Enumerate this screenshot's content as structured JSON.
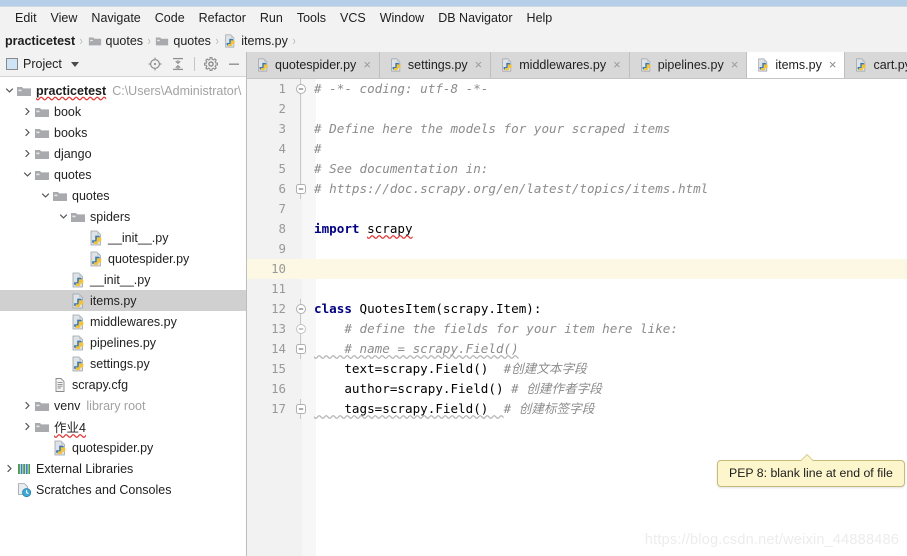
{
  "window": {
    "title_strip_color": "#b6cfe8"
  },
  "menubar": {
    "items": [
      {
        "label": "Edit",
        "mnemonic": "E"
      },
      {
        "label": "View",
        "mnemonic": "V"
      },
      {
        "label": "Navigate",
        "mnemonic": "N"
      },
      {
        "label": "Code",
        "mnemonic": "C"
      },
      {
        "label": "Refactor",
        "mnemonic": "R"
      },
      {
        "label": "Run",
        "mnemonic": "u"
      },
      {
        "label": "Tools",
        "mnemonic": "T"
      },
      {
        "label": "VCS",
        "mnemonic": "S"
      },
      {
        "label": "Window",
        "mnemonic": "W"
      },
      {
        "label": "DB Navigator",
        "mnemonic": "DB"
      },
      {
        "label": "Help",
        "mnemonic": "H"
      }
    ]
  },
  "breadcrumb": {
    "items": [
      {
        "label": "practicetest",
        "icon": "none",
        "bold": true
      },
      {
        "label": "quotes",
        "icon": "folder-icon",
        "bold": false
      },
      {
        "label": "quotes",
        "icon": "folder-icon",
        "bold": false
      },
      {
        "label": "items.py",
        "icon": "python-file-icon",
        "bold": false
      }
    ],
    "separator": "›"
  },
  "project_panel": {
    "title": "Project",
    "tools": [
      "locate-icon",
      "collapse-all-icon",
      "gear-icon",
      "minimize-icon"
    ],
    "tree": [
      {
        "depth": 0,
        "arrow": "down",
        "icon": "folder-icon",
        "label": "practicetest",
        "bold": true,
        "path": "C:\\Users\\Administrator\\",
        "selected": false,
        "squiggle": true
      },
      {
        "depth": 1,
        "arrow": "right",
        "icon": "folder-icon",
        "label": "book",
        "bold": false,
        "path": "",
        "selected": false,
        "squiggle": false
      },
      {
        "depth": 1,
        "arrow": "right",
        "icon": "folder-icon",
        "label": "books",
        "bold": false,
        "path": "",
        "selected": false,
        "squiggle": false
      },
      {
        "depth": 1,
        "arrow": "right",
        "icon": "folder-icon",
        "label": "django",
        "bold": false,
        "path": "",
        "selected": false,
        "squiggle": false
      },
      {
        "depth": 1,
        "arrow": "down",
        "icon": "folder-icon",
        "label": "quotes",
        "bold": false,
        "path": "",
        "selected": false,
        "squiggle": false
      },
      {
        "depth": 2,
        "arrow": "down",
        "icon": "folder-icon",
        "label": "quotes",
        "bold": false,
        "path": "",
        "selected": false,
        "squiggle": false
      },
      {
        "depth": 3,
        "arrow": "down",
        "icon": "folder-icon",
        "label": "spiders",
        "bold": false,
        "path": "",
        "selected": false,
        "squiggle": false
      },
      {
        "depth": 4,
        "arrow": "none",
        "icon": "python-file-icon",
        "label": "__init__.py",
        "bold": false,
        "path": "",
        "selected": false,
        "squiggle": false
      },
      {
        "depth": 4,
        "arrow": "none",
        "icon": "python-file-icon",
        "label": "quotespider.py",
        "bold": false,
        "path": "",
        "selected": false,
        "squiggle": false
      },
      {
        "depth": 3,
        "arrow": "none",
        "icon": "python-file-icon",
        "label": "__init__.py",
        "bold": false,
        "path": "",
        "selected": false,
        "squiggle": false
      },
      {
        "depth": 3,
        "arrow": "none",
        "icon": "python-file-icon",
        "label": "items.py",
        "bold": false,
        "path": "",
        "selected": true,
        "squiggle": false
      },
      {
        "depth": 3,
        "arrow": "none",
        "icon": "python-file-icon",
        "label": "middlewares.py",
        "bold": false,
        "path": "",
        "selected": false,
        "squiggle": false
      },
      {
        "depth": 3,
        "arrow": "none",
        "icon": "python-file-icon",
        "label": "pipelines.py",
        "bold": false,
        "path": "",
        "selected": false,
        "squiggle": false
      },
      {
        "depth": 3,
        "arrow": "none",
        "icon": "python-file-icon",
        "label": "settings.py",
        "bold": false,
        "path": "",
        "selected": false,
        "squiggle": false
      },
      {
        "depth": 2,
        "arrow": "none",
        "icon": "cfg-file-icon",
        "label": "scrapy.cfg",
        "bold": false,
        "path": "",
        "selected": false,
        "squiggle": false
      },
      {
        "depth": 1,
        "arrow": "right",
        "icon": "folder-icon",
        "label": "venv",
        "bold": false,
        "path": "library root",
        "selected": false,
        "squiggle": false
      },
      {
        "depth": 1,
        "arrow": "right",
        "icon": "folder-icon",
        "label": "作业4",
        "bold": false,
        "path": "",
        "selected": false,
        "squiggle": true
      },
      {
        "depth": 2,
        "arrow": "none",
        "icon": "python-file-icon",
        "label": "quotespider.py",
        "bold": false,
        "path": "",
        "selected": false,
        "squiggle": false
      },
      {
        "depth": 0,
        "arrow": "right",
        "icon": "libraries-icon",
        "label": "External Libraries",
        "bold": false,
        "path": "",
        "selected": false,
        "squiggle": false
      },
      {
        "depth": 0,
        "arrow": "none",
        "icon": "scratches-icon",
        "label": "Scratches and Consoles",
        "bold": false,
        "path": "",
        "selected": false,
        "squiggle": false
      }
    ]
  },
  "editor": {
    "tabs": [
      {
        "label": "quotespider.py",
        "active": false,
        "closable": true
      },
      {
        "label": "settings.py",
        "active": false,
        "closable": true
      },
      {
        "label": "middlewares.py",
        "active": false,
        "closable": true
      },
      {
        "label": "pipelines.py",
        "active": false,
        "closable": true
      },
      {
        "label": "items.py",
        "active": true,
        "closable": true
      },
      {
        "label": "cart.py",
        "active": false,
        "closable": false
      }
    ],
    "current_line": 10,
    "lines": [
      {
        "n": 1,
        "fold": "open-top",
        "segs": [
          {
            "t": "# -*- coding: utf-8 -*-",
            "c": "com"
          }
        ]
      },
      {
        "n": 2,
        "fold": "bar",
        "segs": []
      },
      {
        "n": 3,
        "fold": "bar",
        "segs": [
          {
            "t": "# Define here the models for your scraped items",
            "c": "com"
          }
        ]
      },
      {
        "n": 4,
        "fold": "bar",
        "segs": [
          {
            "t": "#",
            "c": "com"
          }
        ]
      },
      {
        "n": 5,
        "fold": "bar",
        "segs": [
          {
            "t": "# See documentation in:",
            "c": "com"
          }
        ]
      },
      {
        "n": 6,
        "fold": "close-bot",
        "segs": [
          {
            "t": "# https://doc.scrapy.org/en/latest/topics/items.html",
            "c": "com"
          }
        ]
      },
      {
        "n": 7,
        "fold": "none",
        "segs": []
      },
      {
        "n": 8,
        "fold": "none",
        "segs": [
          {
            "t": "import ",
            "c": "kw"
          },
          {
            "t": "scrapy",
            "c": "plain err-squig"
          }
        ]
      },
      {
        "n": 9,
        "fold": "none",
        "segs": []
      },
      {
        "n": 10,
        "fold": "none",
        "segs": []
      },
      {
        "n": 11,
        "fold": "none",
        "segs": []
      },
      {
        "n": 12,
        "fold": "open-top",
        "segs": [
          {
            "t": "class ",
            "c": "kw"
          },
          {
            "t": "QuotesItem(scrapy.Item):",
            "c": "plain"
          }
        ]
      },
      {
        "n": 13,
        "fold": "open2",
        "segs": [
          {
            "t": "    # define the fields for your item here like:",
            "c": "com"
          }
        ]
      },
      {
        "n": 14,
        "fold": "close2",
        "segs": [
          {
            "t": "    # name = scrapy.Field()",
            "c": "com warn-squig"
          }
        ]
      },
      {
        "n": 15,
        "fold": "none",
        "segs": [
          {
            "t": "    text=scrapy.Field()  ",
            "c": "plain"
          },
          {
            "t": "#创建文本字段",
            "c": "com"
          }
        ]
      },
      {
        "n": 16,
        "fold": "none",
        "segs": [
          {
            "t": "    author=scrapy.Field() ",
            "c": "plain"
          },
          {
            "t": "# 创建作者字段",
            "c": "com"
          }
        ]
      },
      {
        "n": 17,
        "fold": "close-bot",
        "segs": [
          {
            "t": "    tags=scrapy.Field()  ",
            "c": "plain warn-squig"
          },
          {
            "t": "# 创建标签字段",
            "c": "com"
          }
        ]
      }
    ]
  },
  "tooltip": {
    "text": "PEP 8: blank line at end of file"
  },
  "watermark": {
    "text": "https://blog.csdn.net/weixin_44888486"
  }
}
